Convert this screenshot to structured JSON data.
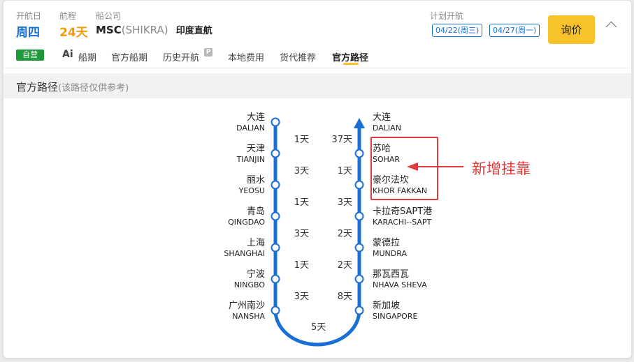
{
  "header": {
    "depart_label": "开航日",
    "depart_value": "周四",
    "voyage_label": "航程",
    "voyage_value": "24天",
    "carrier_label": "船公司",
    "carrier_code": "MSC",
    "carrier_vessel": "(SHIKRA)",
    "route_type": "印度直航",
    "plan_label": "计划开航",
    "plan_dates": [
      "04/22(周三)",
      "04/27(周一)"
    ],
    "inquiry_button": "询价"
  },
  "tabs": {
    "badge": "自营",
    "ai_mark": "Ai",
    "items": [
      "船期",
      "官方船期",
      "历史开航",
      "本地费用",
      "货代推荐",
      "官方路径"
    ],
    "active": "官方路径"
  },
  "section": {
    "title": "官方路径",
    "subtitle": "(该路径仅供参考)"
  },
  "route": {
    "outbound": [
      {
        "zh": "大连",
        "en": "DALIAN"
      },
      {
        "zh": "天津",
        "en": "TIANJIN"
      },
      {
        "zh": "丽水",
        "en": "YEOSU"
      },
      {
        "zh": "青岛",
        "en": "QINGDAO"
      },
      {
        "zh": "上海",
        "en": "SHANGHAI"
      },
      {
        "zh": "宁波",
        "en": "NINGBO"
      },
      {
        "zh": "广州南沙",
        "en": "NANSHA"
      }
    ],
    "outbound_days": [
      "1天",
      "3天",
      "1天",
      "3天",
      "1天",
      "3天"
    ],
    "bottom_days": "5天",
    "inbound": [
      {
        "zh": "大连",
        "en": "DALIAN"
      },
      {
        "zh": "苏哈",
        "en": "SOHAR"
      },
      {
        "zh": "豪尔法坎",
        "en": "KHOR FAKKAN"
      },
      {
        "zh": "卡拉奇SAPT港",
        "en": "KARACHI--SAPT"
      },
      {
        "zh": "蒙德拉",
        "en": "MUNDRA"
      },
      {
        "zh": "那瓦西瓦",
        "en": "NHAVA SHEVA"
      },
      {
        "zh": "新加坡",
        "en": "SINGAPORE"
      }
    ],
    "inbound_days": [
      "37天",
      "1天",
      "3天",
      "2天",
      "2天",
      "8天"
    ],
    "annotation": "新增挂靠",
    "line_color": "#1a6fd6",
    "annotation_color": "#e03a3a"
  }
}
